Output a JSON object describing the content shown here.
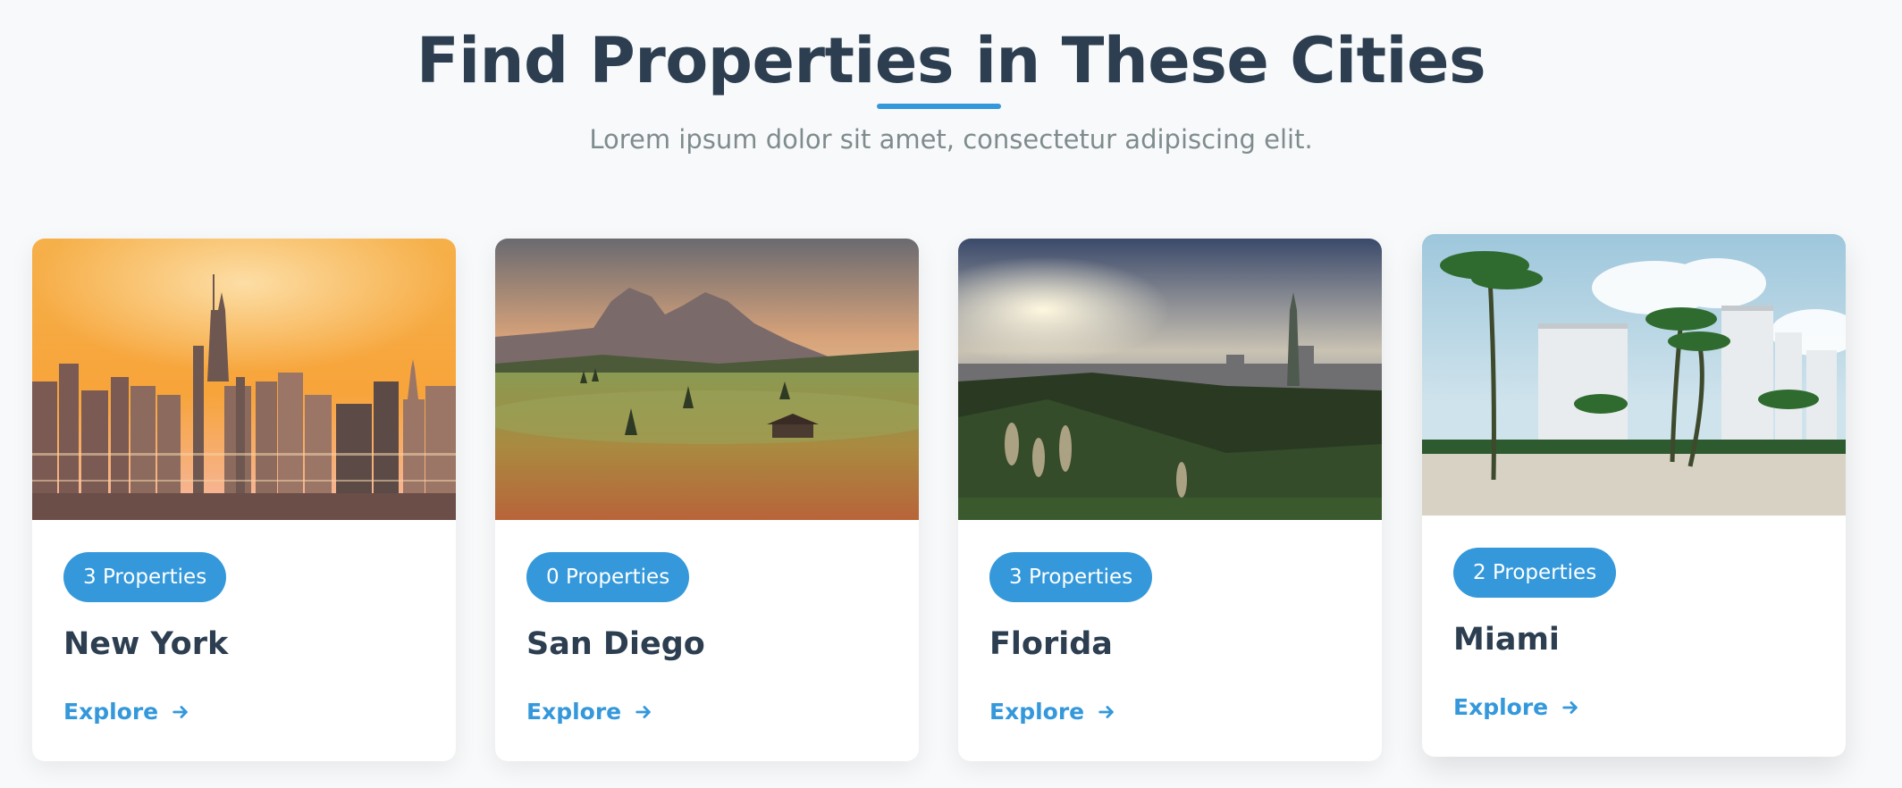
{
  "header": {
    "title": "Find Properties in These Cities",
    "subtitle": "Lorem ipsum dolor sit amet, consectetur adipiscing elit."
  },
  "colors": {
    "accent": "#3498db",
    "heading": "#2c3e50",
    "muted": "#7f8c8d",
    "background": "#f8f9fa"
  },
  "cities": [
    {
      "name": "New York",
      "properties": "3 Properties",
      "explore": "Explore",
      "arrow_icon": "arrow-right-icon",
      "image": "city-skyline-sunset-photo"
    },
    {
      "name": "San Diego",
      "properties": "0 Properties",
      "explore": "Explore",
      "arrow_icon": "arrow-right-icon",
      "image": "mountain-meadow-photo"
    },
    {
      "name": "Florida",
      "properties": "3 Properties",
      "explore": "Explore",
      "arrow_icon": "arrow-right-icon",
      "image": "city-tower-clouds-photo"
    },
    {
      "name": "Miami",
      "properties": "2 Properties",
      "explore": "Explore",
      "arrow_icon": "arrow-right-icon",
      "image": "palm-beach-photo"
    }
  ]
}
